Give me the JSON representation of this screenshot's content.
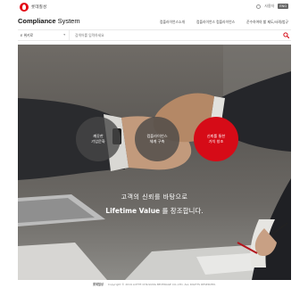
{
  "top": {
    "logo_text": "롯데칠성",
    "utils": [
      "사용자",
      "ENG"
    ]
  },
  "header": {
    "brand_bold": "Compliance",
    "brand_rest": " System",
    "gnb": [
      "컴플라이언스소개",
      "컴플라이언스 컴플라이언스",
      "준수하여야 할 제도/사례/법규"
    ]
  },
  "search": {
    "scope_label": "E 위키로",
    "placeholder": "검색어를 입력하세요"
  },
  "hero": {
    "circles": [
      {
        "line1": "깨끗한",
        "line2": "기업문화"
      },
      {
        "line1": "컴플라이언스",
        "line2": "체계 구축"
      },
      {
        "line1": "신뢰를 통한",
        "line2": "가치 창조"
      }
    ],
    "tagline1": "고객의 신뢰를 바탕으로",
    "tagline2_bold": "Lifetime Value",
    "tagline2_rest": " 를 창조합니다."
  },
  "footer": {
    "logo": "롯데칠성",
    "copyright": "Copyright © 2019 LOTTE CHILSUNG BEVERAGE CO.,LTD. ALL RIGHTS RESERVED."
  },
  "colors": {
    "brand_red": "#d60b17"
  }
}
